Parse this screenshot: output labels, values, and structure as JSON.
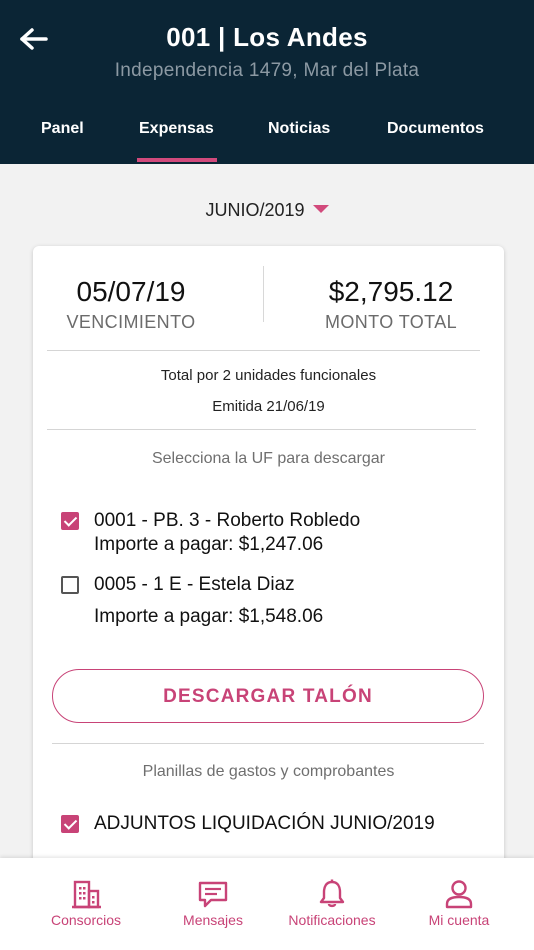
{
  "header": {
    "title": "001 | Los Andes",
    "subtitle": "Independencia 1479,  Mar del Plata",
    "tabs": [
      {
        "label": "Panel",
        "active": false
      },
      {
        "label": "Expensas",
        "active": true
      },
      {
        "label": "Noticias",
        "active": false
      },
      {
        "label": "Documentos",
        "active": false
      }
    ]
  },
  "month_selector": {
    "value": "JUNIO/2019"
  },
  "summary": {
    "due_date": "05/07/19",
    "due_label": "VENCIMIENTO",
    "total": "$2,795.12",
    "total_label": "MONTO TOTAL",
    "units_text": "Total por 2 unidades funcionales",
    "issued_text": "Emitida 21/06/19"
  },
  "uf_section": {
    "heading": "Selecciona la UF para descargar",
    "items": [
      {
        "name": "0001 - PB. 3 - Roberto Robledo",
        "amount": "Importe a pagar: $1,247.06",
        "checked": true
      },
      {
        "name": "0005 - 1 E - Estela Diaz",
        "amount": "Importe a pagar: $1,548.06",
        "checked": false
      }
    ],
    "download_label": "DESCARGAR TALÓN"
  },
  "attachments": {
    "heading": "Planillas de gastos y comprobantes",
    "items": [
      {
        "label": "ADJUNTOS LIQUIDACIÓN JUNIO/2019",
        "checked": true
      }
    ]
  },
  "bottom_nav": {
    "items": [
      {
        "label": "Consorcios",
        "icon": "building-icon"
      },
      {
        "label": "Mensajes",
        "icon": "message-icon"
      },
      {
        "label": "Notificaciones",
        "icon": "bell-icon"
      },
      {
        "label": "Mi cuenta",
        "icon": "user-icon"
      }
    ]
  },
  "colors": {
    "header_bg": "#0b2535",
    "accent": "#c84377",
    "background": "#f2f2f2"
  }
}
